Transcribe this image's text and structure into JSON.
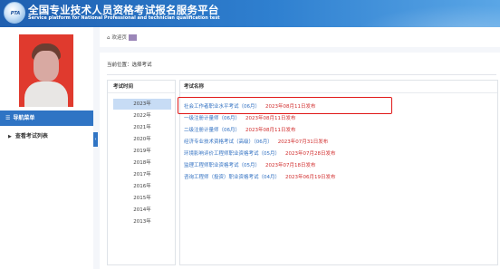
{
  "header": {
    "logo_text": "PTA",
    "title": "全国专业技术人员资格考试报名服务平台",
    "subtitle": "Service platform for National Professional and technician qualification test"
  },
  "sidebar": {
    "nav_header": "导航菜单",
    "items": [
      {
        "label": "查看考试列表"
      }
    ],
    "collapse_glyph": "‹"
  },
  "topbar": {
    "home_tab_label": "欢迎页"
  },
  "main": {
    "breadcrumb": "当前位置：选择考试",
    "years_header": "考试时间",
    "years": [
      "2023年",
      "2022年",
      "2021年",
      "2020年",
      "2019年",
      "2018年",
      "2017年",
      "2016年",
      "2015年",
      "2014年",
      "2013年"
    ],
    "selected_year": "2023年",
    "exams_header": "考试名称",
    "exams": [
      {
        "name": "社会工作者职业水平考试（06月）",
        "date": "2023年08月11日发布"
      },
      {
        "name": "一级注册计量师（06月）",
        "date": "2023年08月11日发布"
      },
      {
        "name": "二级注册计量师（06月）",
        "date": "2023年08月11日发布"
      },
      {
        "name": "经济专业技术资格考试（高级）（06月）",
        "date": "2023年07月31日发布"
      },
      {
        "name": "环境影响评价工程师职业资格考试（05月）",
        "date": "2023年07月28日发布"
      },
      {
        "name": "监理工程师职业资格考试（05月）",
        "date": "2023年07月18日发布"
      },
      {
        "name": "咨询工程师（投资）职业资格考试（04月）",
        "date": "2023年06月19日发布"
      }
    ]
  },
  "colors": {
    "header_blue": "#2f80d0",
    "nav_blue": "#2f74c4",
    "selected_year_bg": "#c7dcf5",
    "link_blue": "#2f6fc1",
    "date_red": "#d12d2d",
    "highlight_red": "#e01818"
  },
  "icons": {
    "home": "home-icon",
    "nav": "menu-icon",
    "list": "list-icon"
  }
}
